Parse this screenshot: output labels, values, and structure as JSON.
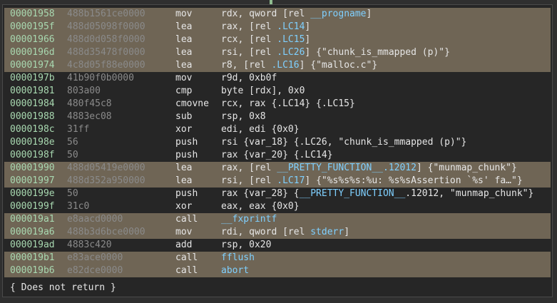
{
  "rows": [
    {
      "addr": "00001958",
      "bytes": "488b1561ce0000",
      "mnem": "mov",
      "hl": true,
      "ops": [
        [
          "rdx, qword [rel ",
          ""
        ],
        [
          "__progname",
          "sym"
        ],
        [
          "]",
          ""
        ]
      ]
    },
    {
      "addr": "0000195f",
      "bytes": "488d05098f0000",
      "mnem": "lea",
      "hl": true,
      "ops": [
        [
          "rax, [rel ",
          ""
        ],
        [
          ".LC14",
          "sym"
        ],
        [
          "]",
          ""
        ]
      ]
    },
    {
      "addr": "00001966",
      "bytes": "488d0d058f0000",
      "mnem": "lea",
      "hl": true,
      "ops": [
        [
          "rcx, [rel ",
          ""
        ],
        [
          ".LC15",
          "sym"
        ],
        [
          "]",
          ""
        ]
      ]
    },
    {
      "addr": "0000196d",
      "bytes": "488d35478f0000",
      "mnem": "lea",
      "hl": true,
      "ops": [
        [
          "rsi, [rel ",
          ""
        ],
        [
          ".LC26",
          "sym"
        ],
        [
          "]  {\"chunk_is_mmapped (p)\"}",
          ""
        ]
      ]
    },
    {
      "addr": "00001974",
      "bytes": "4c8d05f88e0000",
      "mnem": "lea",
      "hl": true,
      "ops": [
        [
          "r8, [rel ",
          ""
        ],
        [
          ".LC16",
          "sym"
        ],
        [
          "]  {\"malloc.c\"}",
          ""
        ]
      ]
    },
    {
      "addr": "0000197b",
      "bytes": "41b90f0b0000",
      "mnem": "mov",
      "hl": false,
      "ops": [
        [
          "r9d, 0xb0f",
          ""
        ]
      ]
    },
    {
      "addr": "00001981",
      "bytes": "803a00",
      "mnem": "cmp",
      "hl": false,
      "ops": [
        [
          "byte [rdx], 0x0",
          ""
        ]
      ]
    },
    {
      "addr": "00001984",
      "bytes": "480f45c8",
      "mnem": "cmovne",
      "hl": false,
      "ops": [
        [
          "rcx, rax  {.LC14}  {.LC15}",
          ""
        ]
      ]
    },
    {
      "addr": "00001988",
      "bytes": "4883ec08",
      "mnem": "sub",
      "hl": false,
      "ops": [
        [
          "rsp, 0x8",
          ""
        ]
      ]
    },
    {
      "addr": "0000198c",
      "bytes": "31ff",
      "mnem": "xor",
      "hl": false,
      "ops": [
        [
          "edi, edi  {0x0}",
          ""
        ]
      ]
    },
    {
      "addr": "0000198e",
      "bytes": "56",
      "mnem": "push",
      "hl": false,
      "ops": [
        [
          "rsi {var_18}  {.LC26, \"chunk_is_mmapped (p)\"}",
          ""
        ]
      ]
    },
    {
      "addr": "0000198f",
      "bytes": "50",
      "mnem": "push",
      "hl": false,
      "ops": [
        [
          "rax {var_20}  {.LC14}",
          ""
        ]
      ]
    },
    {
      "addr": "00001990",
      "bytes": "488d05419e0000",
      "mnem": "lea",
      "hl": true,
      "ops": [
        [
          "rax, [rel ",
          ""
        ],
        [
          "__PRETTY_FUNCTION__.12012",
          "sym"
        ],
        [
          "]  {\"munmap_chunk\"}",
          ""
        ]
      ]
    },
    {
      "addr": "00001997",
      "bytes": "488d352a950000",
      "mnem": "lea",
      "hl": true,
      "ops": [
        [
          "rsi, [rel ",
          ""
        ],
        [
          ".LC17",
          "sym"
        ],
        [
          "]  {\"%s%s%s:%u: %s%sAssertion `%s' fa…\"}",
          ""
        ]
      ]
    },
    {
      "addr": "0000199e",
      "bytes": "50",
      "mnem": "push",
      "hl": false,
      "ops": [
        [
          "rax {var_28}  {",
          ""
        ],
        [
          "__PRETTY_FUNCTION__",
          "sym"
        ],
        [
          ".12012, \"munmap_chunk\"}",
          ""
        ]
      ]
    },
    {
      "addr": "0000199f",
      "bytes": "31c0",
      "mnem": "xor",
      "hl": false,
      "ops": [
        [
          "eax, eax  {0x0}",
          ""
        ]
      ]
    },
    {
      "addr": "000019a1",
      "bytes": "e8aacd0000",
      "mnem": "call",
      "hl": true,
      "ops": [
        [
          "__fxprintf",
          "sym"
        ]
      ]
    },
    {
      "addr": "000019a6",
      "bytes": "488b3d6bce0000",
      "mnem": "mov",
      "hl": true,
      "ops": [
        [
          "rdi, qword [rel ",
          ""
        ],
        [
          "stderr",
          "sym"
        ],
        [
          "]",
          ""
        ]
      ]
    },
    {
      "addr": "000019ad",
      "bytes": "4883c420",
      "mnem": "add",
      "hl": false,
      "ops": [
        [
          "rsp, 0x20",
          ""
        ]
      ]
    },
    {
      "addr": "000019b1",
      "bytes": "e83ace0000",
      "mnem": "call",
      "hl": true,
      "ops": [
        [
          "fflush",
          "sym"
        ]
      ]
    },
    {
      "addr": "000019b6",
      "bytes": "e82dce0000",
      "mnem": "call",
      "hl": true,
      "ops": [
        [
          "abort",
          "sym"
        ]
      ]
    }
  ],
  "footer": "{ Does not return }",
  "colors": {
    "highlight": "#6f6555",
    "address": "#a8d8b0",
    "bytes": "#8a8a8a",
    "symbol": "#7fd0ff"
  }
}
